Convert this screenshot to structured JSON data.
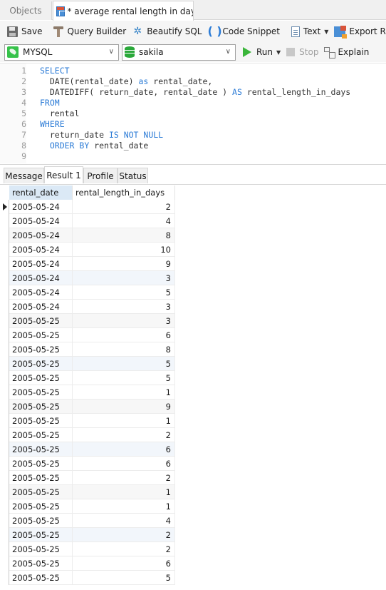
{
  "tabs": {
    "objects_label": "Objects",
    "query_tab_label": "* average rental length in days ..."
  },
  "toolbar": {
    "save": "Save",
    "query_builder": "Query Builder",
    "beautify_sql": "Beautify SQL",
    "code_snippet": "Code Snippet",
    "text": "Text",
    "export_result": "Export Result"
  },
  "connection_bar": {
    "connection": "MYSQL",
    "database": "sakila",
    "run": "Run",
    "stop": "Stop",
    "explain": "Explain"
  },
  "editor": {
    "lines": [
      {
        "n": "1",
        "parts": [
          {
            "t": "SELECT",
            "k": true
          }
        ]
      },
      {
        "n": "2",
        "parts": [
          {
            "t": "  DATE(rental_date) ",
            "k": false
          },
          {
            "t": "as",
            "k": true
          },
          {
            "t": " rental_date,",
            "k": false
          }
        ]
      },
      {
        "n": "3",
        "parts": [
          {
            "t": "  DATEDIFF( return_date, rental_date ) ",
            "k": false
          },
          {
            "t": "AS",
            "k": true
          },
          {
            "t": " rental_length_in_days",
            "k": false
          }
        ]
      },
      {
        "n": "4",
        "parts": [
          {
            "t": "FROM",
            "k": true
          }
        ]
      },
      {
        "n": "5",
        "parts": [
          {
            "t": "  rental",
            "k": false
          }
        ]
      },
      {
        "n": "6",
        "parts": [
          {
            "t": "WHERE",
            "k": true
          }
        ]
      },
      {
        "n": "7",
        "parts": [
          {
            "t": "  return_date ",
            "k": false
          },
          {
            "t": "IS NOT NULL",
            "k": true
          }
        ]
      },
      {
        "n": "8",
        "parts": [
          {
            "t": "  ",
            "k": false
          },
          {
            "t": "ORDER BY",
            "k": true
          },
          {
            "t": " rental_date",
            "k": false
          }
        ]
      },
      {
        "n": "9",
        "parts": []
      }
    ]
  },
  "result_tabs": [
    "Message",
    "Result 1",
    "Profile",
    "Status"
  ],
  "active_result_tab": "Result 1",
  "grid": {
    "columns": [
      "rental_date",
      "rental_length_in_days"
    ],
    "rows": [
      [
        "2005-05-24",
        "2"
      ],
      [
        "2005-05-24",
        "4"
      ],
      [
        "2005-05-24",
        "8"
      ],
      [
        "2005-05-24",
        "10"
      ],
      [
        "2005-05-24",
        "9"
      ],
      [
        "2005-05-24",
        "3"
      ],
      [
        "2005-05-24",
        "5"
      ],
      [
        "2005-05-24",
        "3"
      ],
      [
        "2005-05-25",
        "3"
      ],
      [
        "2005-05-25",
        "6"
      ],
      [
        "2005-05-25",
        "8"
      ],
      [
        "2005-05-25",
        "5"
      ],
      [
        "2005-05-25",
        "5"
      ],
      [
        "2005-05-25",
        "1"
      ],
      [
        "2005-05-25",
        "9"
      ],
      [
        "2005-05-25",
        "1"
      ],
      [
        "2005-05-25",
        "2"
      ],
      [
        "2005-05-25",
        "6"
      ],
      [
        "2005-05-25",
        "6"
      ],
      [
        "2005-05-25",
        "2"
      ],
      [
        "2005-05-25",
        "1"
      ],
      [
        "2005-05-25",
        "1"
      ],
      [
        "2005-05-25",
        "4"
      ],
      [
        "2005-05-25",
        "2"
      ],
      [
        "2005-05-25",
        "2"
      ],
      [
        "2005-05-25",
        "6"
      ],
      [
        "2005-05-25",
        "5"
      ]
    ],
    "current_row_index": 0
  }
}
